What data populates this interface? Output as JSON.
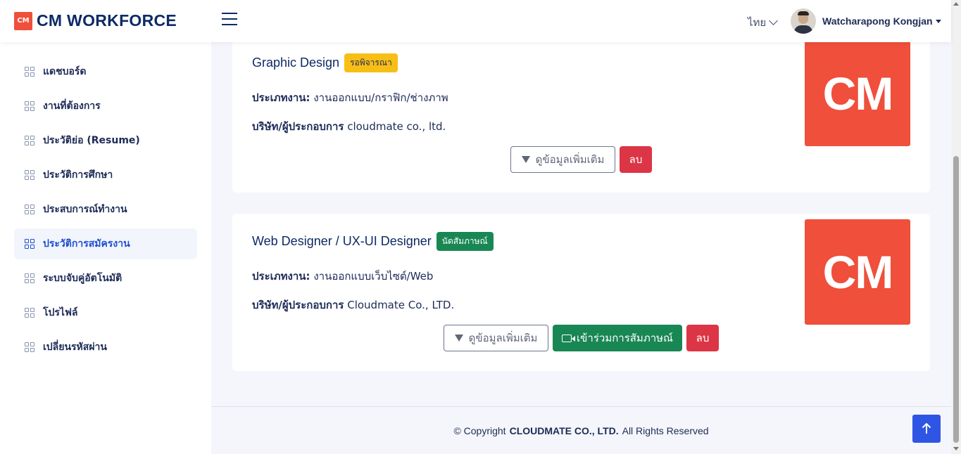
{
  "header": {
    "logo_badge": "CM",
    "logo_text": "CM WORKFORCE",
    "language": "ไทย",
    "user_name": "Watcharapong Kongjan"
  },
  "sidebar": {
    "items": [
      {
        "label": "แดชบอร์ด",
        "active": false
      },
      {
        "label": "งานที่ต้องการ",
        "active": false
      },
      {
        "label": "ประวัติย่อ (Resume)",
        "active": false
      },
      {
        "label": "ประวัติการศึกษา",
        "active": false
      },
      {
        "label": "ประสบการณ์ทำงาน",
        "active": false
      },
      {
        "label": "ประวัติการสมัครงาน",
        "active": true
      },
      {
        "label": "ระบบจับคู่อัตโนมัติ",
        "active": false
      },
      {
        "label": "โปรไฟล์",
        "active": false
      },
      {
        "label": "เปลี่ยนรหัสผ่าน",
        "active": false
      }
    ]
  },
  "applications": [
    {
      "title": "Graphic Design",
      "status": "รอพิจารณา",
      "type_label": "ประเภทงาน:",
      "type_value": "งานออกแบบ/กราฟิก/ช่างภาพ",
      "company_label": "บริษัท/ผู้ประกอบการ",
      "company_value": "cloudmate co., ltd.",
      "logo_text": "CM",
      "more_label": "ดูข้อมูลเพิ่มเติม",
      "delete_label": "ลบ"
    },
    {
      "title": "Web Designer / UX-UI Designer",
      "status": "นัดสัมภาษณ์",
      "type_label": "ประเภทงาน:",
      "type_value": "งานออกแบบเว็บไซต์/Web",
      "company_label": "บริษัท/ผู้ประกอบการ",
      "company_value": "Cloudmate Co., LTD.",
      "logo_text": "CM",
      "more_label": "ดูข้อมูลเพิ่มเติม",
      "join_label": "เข้าร่วมการสัมภาษณ์",
      "delete_label": "ลบ"
    }
  ],
  "footer": {
    "prefix": "© Copyright",
    "company": "CLOUDMATE CO., LTD.",
    "suffix": "All Rights Reserved"
  },
  "colors": {
    "brand": "#ef4f3b",
    "primary": "#2f55e4",
    "success": "#198754",
    "warning": "#f7be16",
    "danger": "#dc3545"
  }
}
